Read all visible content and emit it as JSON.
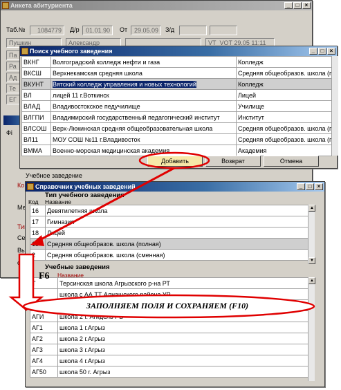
{
  "main_window": {
    "title": "Анкета абитуриента",
    "tab_label": "Таб.№",
    "tab_value": "1084779",
    "dr_label": "Д/р",
    "dr_value": "01.01.90",
    "from_label": "От",
    "from_value": "29.05.09",
    "zd_label": "З/д",
    "surname": "Пушкин",
    "name": "Александр",
    "stamp": "VT_VOT 29.05 11:11",
    "side_fragments": [
      "Па",
      "Ра",
      "Ад",
      "Те",
      "ЕГ"
    ],
    "lower_fragments": [
      "Фі",
      "Ко",
      "Ме",
      "Тип",
      "Се",
      "Вы",
      "от"
    ],
    "education_label": "Учебное заведение"
  },
  "search_dialog": {
    "title": "Поиск учебного заведения",
    "rows": [
      {
        "code": "ВКНГ",
        "name": "Волгоградский колледж нефти и газа",
        "type": "Колледж"
      },
      {
        "code": "ВКСШ",
        "name": "Верхнекамская средняя школа",
        "type": "Средняя общеобразов. школа (г"
      },
      {
        "code": "ВКУНТ",
        "name": "Вятский колледж управления и новых технологий",
        "type": "Колледж"
      },
      {
        "code": "ВЛ",
        "name": "лицей 11 г.Воткинск",
        "type": "Лицей"
      },
      {
        "code": "ВЛАД",
        "name": "Владивостокское педучилище",
        "type": "Училище"
      },
      {
        "code": "ВЛГПИ",
        "name": "Владимирский государственный педагогический институт",
        "type": "Институт"
      },
      {
        "code": "ВЛСОШ",
        "name": "Верх-Люкинская средняя общеобразовательная школа",
        "type": "Средняя общеобразов. школа (г"
      },
      {
        "code": "ВЛ11",
        "name": "МОУ СОШ №11 г.Владивосток",
        "type": "Средняя общеобразов. школа (г"
      },
      {
        "code": "ВММА",
        "name": "Военно-морская медицинская академия",
        "type": "Академия"
      }
    ],
    "add_button": "Добавить",
    "return_button": "Возврат",
    "cancel_button": "Отмена"
  },
  "directory_dialog": {
    "title": "Справочник учебных заведений",
    "type_section": "Тип учебного заведения",
    "code_header": "Код",
    "name_header": "Название",
    "types": [
      {
        "code": "16",
        "name": "Девятилетняя школа"
      },
      {
        "code": "17",
        "name": "Гимназия"
      },
      {
        "code": "18",
        "name": "Лицей"
      },
      {
        "code": "19",
        "name": "Средняя общеобразов. школа (полная)"
      },
      {
        "code": "2",
        "name": "Средняя общеобразов. школа (сменная)"
      }
    ],
    "inst_section": "Учебные заведения",
    "inst_code_header": "К",
    "institutions": [
      {
        "code": "Т",
        "name": "Терсинская школа Агрызского р-на РТ"
      },
      {
        "code": "",
        "name": "школа с АА ТТ Алнашского района УР"
      },
      {
        "code": "",
        "name": ""
      },
      {
        "code": "АГИ",
        "name": "школа 2 г. Агидель РБ"
      },
      {
        "code": "АГ1",
        "name": "школа 1 г.Агрыз"
      },
      {
        "code": "АГ2",
        "name": "школа 2 г.Агрыз"
      },
      {
        "code": "АГ3",
        "name": "школа 3 г.Агрыз"
      },
      {
        "code": "АГ4",
        "name": "школа 4 г.Агрыз"
      },
      {
        "code": "АГ50",
        "name": "школа 50 г. Агрыз"
      }
    ]
  },
  "annotations": {
    "f6": "F6",
    "instruction": "ЗАПОЛНЯЕМ  ПОЛЯ И СОХРАНЯЕМ (F10)"
  },
  "colors": {
    "title_active": "#0a246a",
    "annotation_red": "#e00000",
    "selection": "#cfcfcf"
  }
}
